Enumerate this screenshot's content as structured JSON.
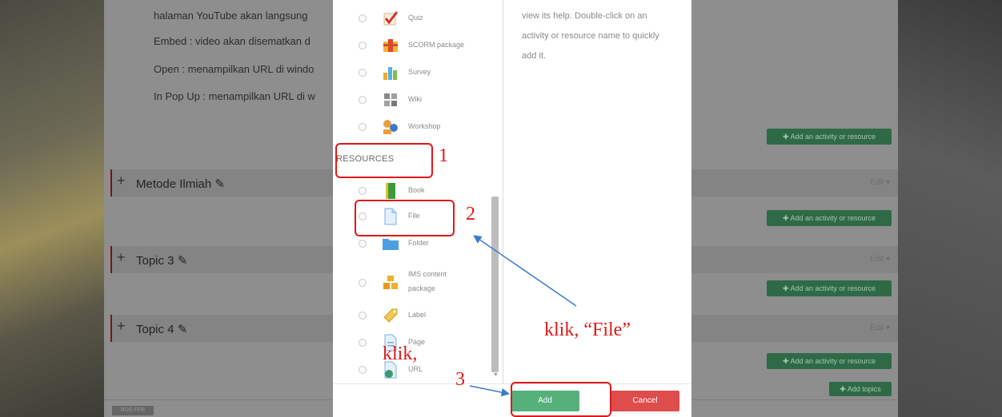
{
  "course": {
    "intro_lines": [
      "halaman YouTube akan langsung",
      "Embed : video akan disematkan d",
      "Open : menampilkan URL di windo",
      "In Pop Up : menampilkan URL di w"
    ],
    "add_activity_label": "Add an activity or resource",
    "add_topics_label": "Add topics",
    "edit_label": "Edit",
    "topics": [
      {
        "title": "Metode Ilmiah"
      },
      {
        "title": "Topic 3"
      },
      {
        "title": "Topic 4"
      }
    ],
    "footer_chip": "BOS FFR"
  },
  "chooser": {
    "help_text": "view its help. Double-click on an activity or resource name to quickly add it.",
    "activities": [
      {
        "label": "Quiz",
        "icon": "quiz-icon"
      },
      {
        "label": "SCORM package",
        "icon": "scorm-package-icon"
      },
      {
        "label": "Survey",
        "icon": "survey-icon"
      },
      {
        "label": "Wiki",
        "icon": "wiki-icon"
      },
      {
        "label": "Workshop",
        "icon": "workshop-icon"
      }
    ],
    "resources_heading": "RESOURCES",
    "resources": [
      {
        "label": "Book",
        "icon": "book-icon"
      },
      {
        "label": "File",
        "icon": "file-icon"
      },
      {
        "label": "Folder",
        "icon": "folder-icon"
      },
      {
        "label_line1": "IMS content",
        "label_line2": "package",
        "icon": "ims-content-package-icon"
      },
      {
        "label": "Label",
        "icon": "label-icon"
      },
      {
        "label": "Page",
        "icon": "page-icon"
      },
      {
        "label": "URL",
        "icon": "url-icon"
      }
    ],
    "add_button": "Add",
    "cancel_button": "Cancel"
  },
  "annotations": {
    "num1": "1",
    "num2": "2",
    "num3": "3",
    "klik_file": "klik, “File”",
    "klik": "klik,",
    "color": "#e01818"
  },
  "colors": {
    "add_button": "#55b07a",
    "cancel_button": "#de4c4c",
    "course_green": "#2f6a47"
  }
}
